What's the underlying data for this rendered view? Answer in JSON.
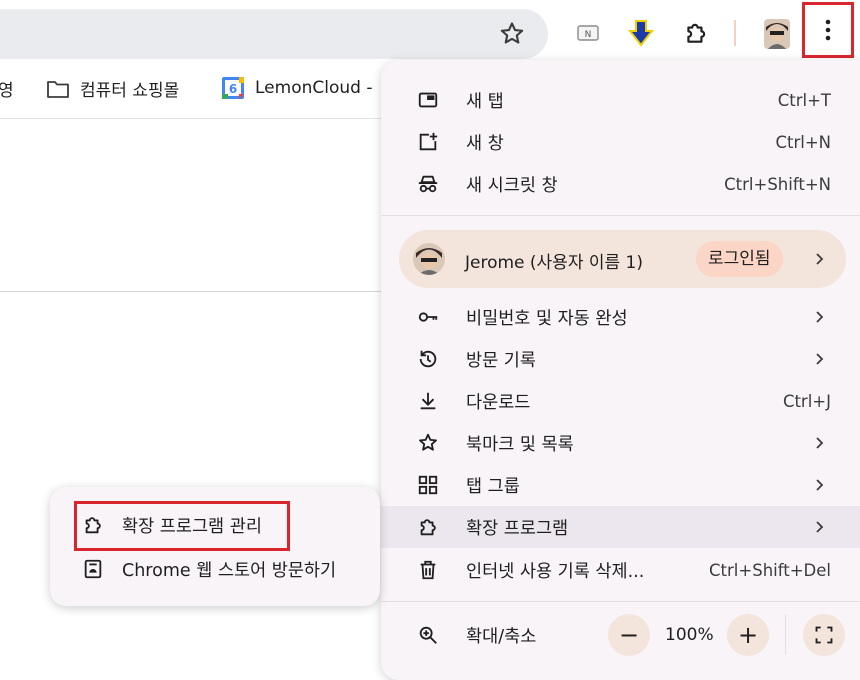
{
  "toolbar": {
    "star_icon": "bookmark-star-icon",
    "extension_icons": [
      "n-extension-icon",
      "download-arrow-icon",
      "puzzle-icon"
    ],
    "menu_icon": "three-dot-menu-icon"
  },
  "bookmarks": {
    "items": [
      {
        "label": "영",
        "icon": "none"
      },
      {
        "label": "컴퓨터 쇼핑몰",
        "icon": "folder-icon"
      },
      {
        "label": "LemonCloud - ",
        "icon": "calendar-6-icon",
        "calendar_day": "6"
      }
    ]
  },
  "menu": {
    "new_tab": {
      "label": "새 탭",
      "shortcut": "Ctrl+T"
    },
    "new_window": {
      "label": "새 창",
      "shortcut": "Ctrl+N"
    },
    "incognito": {
      "label": "새 시크릿 창",
      "shortcut": "Ctrl+Shift+N"
    },
    "profile": {
      "name": "Jerome (사용자 이름 1)",
      "signin": "로그인됨"
    },
    "passwords": {
      "label": "비밀번호 및 자동 완성"
    },
    "history": {
      "label": "방문 기록"
    },
    "downloads": {
      "label": "다운로드",
      "shortcut": "Ctrl+J"
    },
    "bookmarks": {
      "label": "북마크 및 목록"
    },
    "tab_groups": {
      "label": "탭 그룹"
    },
    "extensions": {
      "label": "확장 프로그램"
    },
    "clear_data": {
      "label": "인터넷 사용 기록 삭제...",
      "shortcut": "Ctrl+Shift+Del"
    },
    "zoom": {
      "label": "확대/축소",
      "minus": "−",
      "value": "100%",
      "plus": "+"
    }
  },
  "submenu": {
    "manage": {
      "label": "확장 프로그램 관리"
    },
    "webstore": {
      "label": "Chrome 웹 스토어 방문하기"
    }
  },
  "colors": {
    "highlight_box": "#d9262e",
    "menu_bg": "#f8f4f8",
    "accent_bg": "#f3e4dc",
    "signin_bg": "#fbd5c5"
  }
}
